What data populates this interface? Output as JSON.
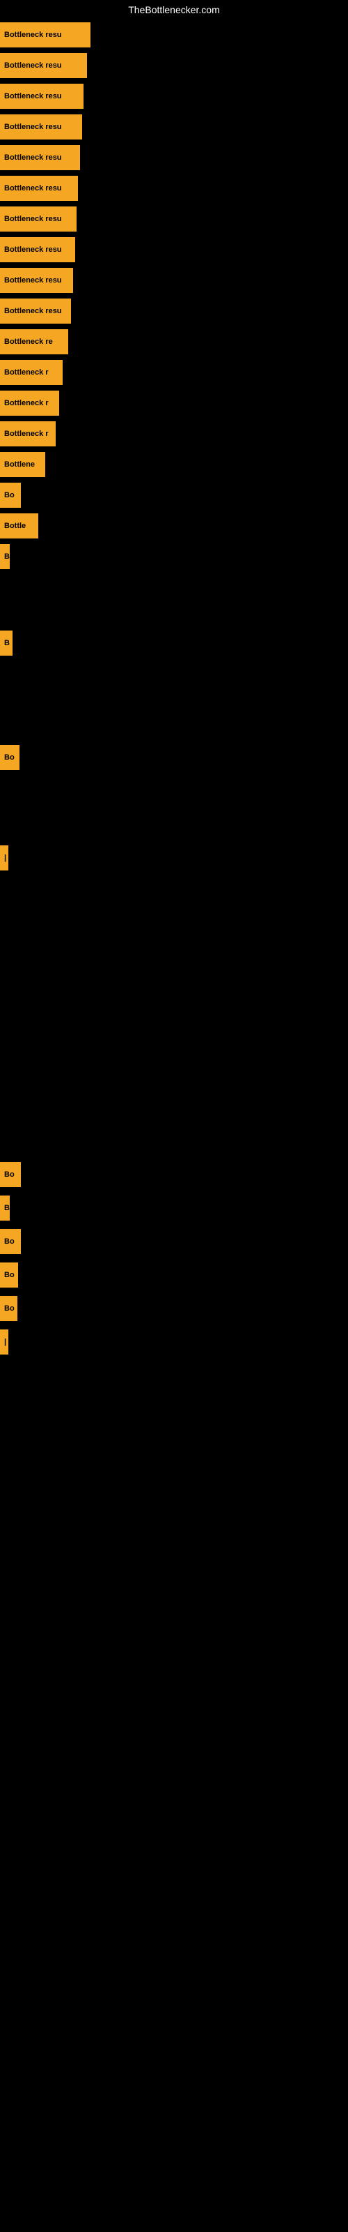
{
  "site": {
    "title": "TheBottlenecker.com"
  },
  "rows": [
    {
      "id": 1,
      "label": "Bottleneck resu",
      "width": 130
    },
    {
      "id": 2,
      "label": "Bottleneck resu",
      "width": 125
    },
    {
      "id": 3,
      "label": "Bottleneck resu",
      "width": 120
    },
    {
      "id": 4,
      "label": "Bottleneck resu",
      "width": 118
    },
    {
      "id": 5,
      "label": "Bottleneck resu",
      "width": 115
    },
    {
      "id": 6,
      "label": "Bottleneck resu",
      "width": 112
    },
    {
      "id": 7,
      "label": "Bottleneck resu",
      "width": 110
    },
    {
      "id": 8,
      "label": "Bottleneck resu",
      "width": 108
    },
    {
      "id": 9,
      "label": "Bottleneck resu",
      "width": 105
    },
    {
      "id": 10,
      "label": "Bottleneck resu",
      "width": 102
    },
    {
      "id": 11,
      "label": "Bottleneck re",
      "width": 98
    },
    {
      "id": 12,
      "label": "Bottleneck r",
      "width": 90
    },
    {
      "id": 13,
      "label": "Bottleneck r",
      "width": 85
    },
    {
      "id": 14,
      "label": "Bottleneck r",
      "width": 80
    },
    {
      "id": 15,
      "label": "Bottlene",
      "width": 65
    },
    {
      "id": 16,
      "label": "Bo",
      "width": 30
    },
    {
      "id": 17,
      "label": "Bottle",
      "width": 55
    },
    {
      "id": 18,
      "label": "B",
      "width": 14
    }
  ],
  "colors": {
    "background": "#000000",
    "bar": "#f5a623",
    "text_bar": "#000000",
    "text_title": "#ffffff"
  }
}
